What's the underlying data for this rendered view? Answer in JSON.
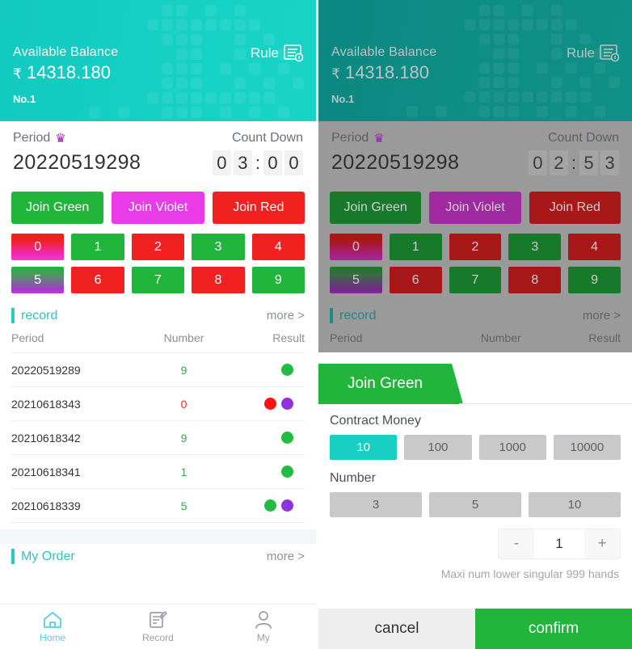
{
  "header": {
    "balance_label": "Available Balance",
    "currency_symbol": "₹",
    "balance_amount": "14318.180",
    "tier": "No.1",
    "rule_label": "Rule",
    "rule_icon": "document-info-icon",
    "bg_color": "#15cfc4",
    "bg_color_dimmed": "#0e8d85"
  },
  "period": {
    "label": "Period",
    "crown_icon": "crown-icon",
    "countdown_label": "Count Down",
    "number": "20220519298",
    "countdown_left": [
      "0",
      "3",
      "0",
      "0"
    ],
    "countdown_right": [
      "0",
      "2",
      "5",
      "3"
    ],
    "colon": ":"
  },
  "join_buttons": [
    {
      "label": "Join Green",
      "color": "#21b53c",
      "kind": "green"
    },
    {
      "label": "Join Violet",
      "color": "#e93ce8",
      "kind": "violet"
    },
    {
      "label": "Join Red",
      "color": "#f22121",
      "kind": "red"
    }
  ],
  "numbers": [
    {
      "label": "0",
      "style": "grad-red-magenta"
    },
    {
      "label": "1",
      "style": "green"
    },
    {
      "label": "2",
      "style": "red"
    },
    {
      "label": "3",
      "style": "green"
    },
    {
      "label": "4",
      "style": "red"
    },
    {
      "label": "5",
      "style": "grad-green-violet"
    },
    {
      "label": "6",
      "style": "red"
    },
    {
      "label": "7",
      "style": "green"
    },
    {
      "label": "8",
      "style": "red"
    },
    {
      "label": "9",
      "style": "green"
    }
  ],
  "record": {
    "title": "record",
    "more": "more >",
    "columns": [
      "Period",
      "Number",
      "Result"
    ],
    "rows": [
      {
        "period": "20220519289",
        "number": "9",
        "number_color": "green",
        "dots": [
          "green"
        ]
      },
      {
        "period": "20210618343",
        "number": "0",
        "number_color": "red",
        "dots": [
          "red",
          "violet"
        ]
      },
      {
        "period": "20210618342",
        "number": "9",
        "number_color": "green",
        "dots": [
          "green"
        ]
      },
      {
        "period": "20210618341",
        "number": "1",
        "number_color": "green",
        "dots": [
          "green"
        ]
      },
      {
        "period": "20210618339",
        "number": "5",
        "number_color": "green",
        "dots": [
          "green",
          "violet"
        ]
      }
    ]
  },
  "my_order": {
    "title": "My Order",
    "more": "more >"
  },
  "bottom_nav": [
    {
      "label": "Home",
      "icon": "home-icon",
      "active": true
    },
    {
      "label": "Record",
      "icon": "record-note-icon",
      "active": false
    },
    {
      "label": "My",
      "icon": "user-icon",
      "active": false
    }
  ],
  "modal": {
    "title": "Join Green",
    "contract_money_label": "Contract Money",
    "contract_money_options": [
      "10",
      "100",
      "1000",
      "10000"
    ],
    "contract_money_selected": "10",
    "number_label": "Number",
    "number_options": [
      "3",
      "5",
      "10"
    ],
    "stepper": {
      "minus": "-",
      "plus": "+",
      "value": "1"
    },
    "hint": "Maxi num lower singular 999 hands",
    "cancel_label": "cancel",
    "confirm_label": "confirm",
    "accent_color": "#21b53c",
    "selected_color": "#19cfc4"
  }
}
